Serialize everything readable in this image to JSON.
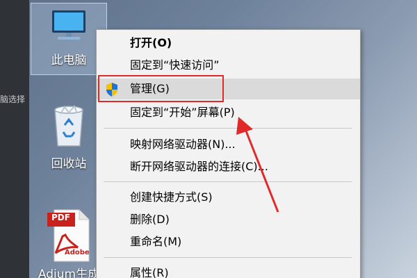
{
  "desktop": {
    "left_strip_text": "脑选择",
    "icons": [
      {
        "label": "此电脑"
      },
      {
        "label": "回收站"
      },
      {
        "label": "Adium生成",
        "pdf_badge": "PDF",
        "brand": "Adobe"
      }
    ]
  },
  "context_menu": {
    "items": [
      {
        "label": "打开(O)"
      },
      {
        "label": "固定到“快速访问”"
      },
      {
        "label": "管理(G)",
        "icon": "uac-shield-icon"
      },
      {
        "label": "固定到“开始”屏幕(P)"
      },
      {
        "label": "映射网络驱动器(N)..."
      },
      {
        "label": "断开网络驱动器的连接(C)..."
      },
      {
        "label": "创建快捷方式(S)"
      },
      {
        "label": "删除(D)"
      },
      {
        "label": "重命名(M)"
      },
      {
        "label": "属性(R)"
      }
    ]
  },
  "colors": {
    "highlight": "#e02a2a",
    "menu_bg": "#f2f2f2"
  }
}
